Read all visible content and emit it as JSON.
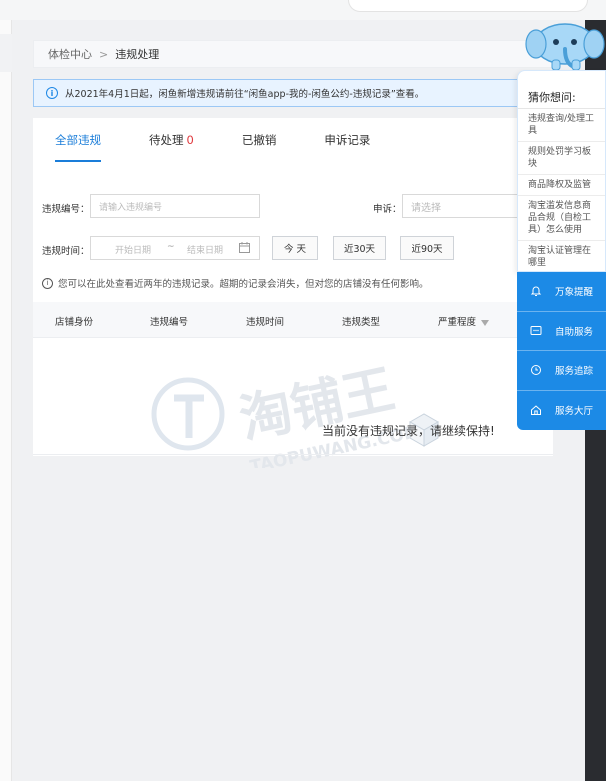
{
  "breadcrumb": {
    "parent": "体检中心",
    "separator": ">",
    "current": "违规处理"
  },
  "notice": {
    "text": "从2021年4月1日起，闲鱼新增违规请前往“闲鱼app-我的-闲鱼公约-违规记录”查看。"
  },
  "tabs": [
    {
      "label": "全部违规",
      "active": true
    },
    {
      "label": "待处理",
      "count": "0"
    },
    {
      "label": "已撤销"
    },
    {
      "label": "申诉记录"
    }
  ],
  "filters": {
    "violation_no_label": "违规编号：",
    "violation_no_placeholder": "请输入违规编号",
    "appeal_label": "申诉：",
    "appeal_placeholder": "请选择",
    "time_label": "违规时间：",
    "start_placeholder": "开始日期",
    "range_sep": "~",
    "end_placeholder": "结束日期",
    "btn_today": "今 天",
    "btn_30": "近30天",
    "btn_90": "近90天"
  },
  "tip": {
    "text": "您可以在此处查看近两年的违规记录。超期的记录会消失，但对您的店铺没有任何影响。"
  },
  "table": {
    "columns": [
      "店铺身份",
      "违规编号",
      "违规时间",
      "违规类型",
      "严重程度"
    ],
    "empty_text": "当前没有违规记录，请继续保持!"
  },
  "watermark": {
    "brand": "淘铺王",
    "domain": "TAOPUWANG.COM"
  },
  "guess": {
    "title": "猜你想问:",
    "items": [
      "违规查询/处理工具",
      "规则处罚学习板块",
      "商品降权及监管",
      "淘宝滥发信息商品合规（自检工具）怎么使用",
      "淘宝认证管理在哪里"
    ]
  },
  "services": [
    {
      "label": "万象提醒",
      "icon": "bell-icon"
    },
    {
      "label": "自助服务",
      "icon": "chat-icon"
    },
    {
      "label": "服务追踪",
      "icon": "clock-icon"
    },
    {
      "label": "服务大厅",
      "icon": "home-icon"
    }
  ],
  "colors": {
    "accent": "#1a7dd9",
    "notice_bg": "#e8f3ff",
    "count_red": "#e0393e",
    "service_blue": "#1c8ae6"
  }
}
